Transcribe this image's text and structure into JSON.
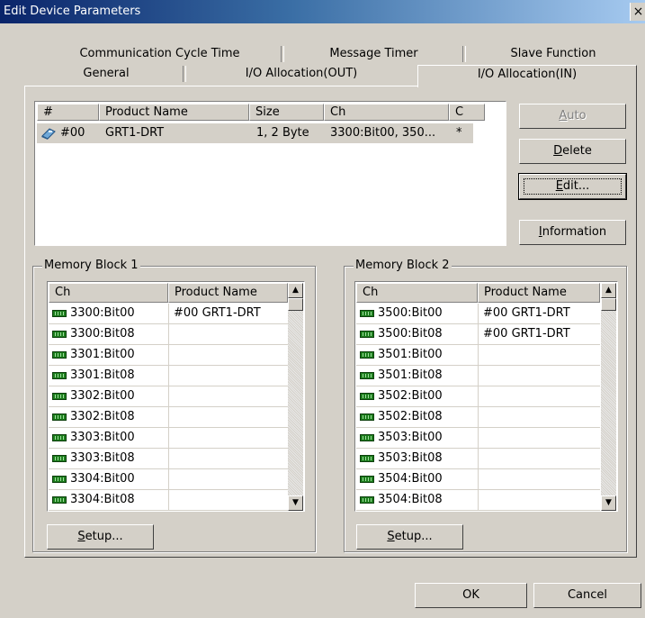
{
  "window": {
    "title": "Edit Device Parameters",
    "close_glyph": "×"
  },
  "tabs": {
    "row1": [
      "Communication Cycle Time",
      "Message Timer",
      "Slave Function"
    ],
    "row2": [
      "General",
      "I/O Allocation(OUT)",
      "I/O Allocation(IN)"
    ],
    "active": "I/O Allocation(IN)"
  },
  "device_list": {
    "headers": [
      "#",
      "Product Name",
      "Size",
      "Ch",
      "C"
    ],
    "rows": [
      {
        "num": "#00",
        "product": "GRT1-DRT",
        "size": "1, 2 Byte",
        "ch": "3300:Bit00, 350...",
        "c": "*",
        "icon": "device-icon"
      }
    ]
  },
  "side_buttons": {
    "auto": {
      "label_pre": "",
      "mnemonic": "A",
      "label_post": "uto"
    },
    "delete": {
      "label_pre": "",
      "mnemonic": "D",
      "label_post": "elete"
    },
    "edit": {
      "label_pre": "",
      "mnemonic": "E",
      "label_post": "dit..."
    },
    "information": {
      "label_pre": "",
      "mnemonic": "I",
      "label_post": "nformation"
    }
  },
  "memory_block_1": {
    "title": "Memory Block 1",
    "headers": [
      "Ch",
      "Product Name"
    ],
    "rows": [
      {
        "ch": "3300:Bit00",
        "product": "#00 GRT1-DRT"
      },
      {
        "ch": "3300:Bit08",
        "product": ""
      },
      {
        "ch": "3301:Bit00",
        "product": ""
      },
      {
        "ch": "3301:Bit08",
        "product": ""
      },
      {
        "ch": "3302:Bit00",
        "product": ""
      },
      {
        "ch": "3302:Bit08",
        "product": ""
      },
      {
        "ch": "3303:Bit00",
        "product": ""
      },
      {
        "ch": "3303:Bit08",
        "product": ""
      },
      {
        "ch": "3304:Bit00",
        "product": ""
      },
      {
        "ch": "3304:Bit08",
        "product": ""
      }
    ],
    "setup": {
      "mnemonic": "S",
      "label_post": "etup..."
    }
  },
  "memory_block_2": {
    "title": "Memory Block 2",
    "headers": [
      "Ch",
      "Product Name"
    ],
    "rows": [
      {
        "ch": "3500:Bit00",
        "product": "#00 GRT1-DRT"
      },
      {
        "ch": "3500:Bit08",
        "product": "#00 GRT1-DRT"
      },
      {
        "ch": "3501:Bit00",
        "product": ""
      },
      {
        "ch": "3501:Bit08",
        "product": ""
      },
      {
        "ch": "3502:Bit00",
        "product": ""
      },
      {
        "ch": "3502:Bit08",
        "product": ""
      },
      {
        "ch": "3503:Bit00",
        "product": ""
      },
      {
        "ch": "3503:Bit08",
        "product": ""
      },
      {
        "ch": "3504:Bit00",
        "product": ""
      },
      {
        "ch": "3504:Bit08",
        "product": ""
      }
    ],
    "setup": {
      "mnemonic": "S",
      "label_post": "etup..."
    }
  },
  "scroll": {
    "up_glyph": "▲",
    "down_glyph": "▼"
  },
  "footer": {
    "ok": "OK",
    "cancel": "Cancel"
  }
}
